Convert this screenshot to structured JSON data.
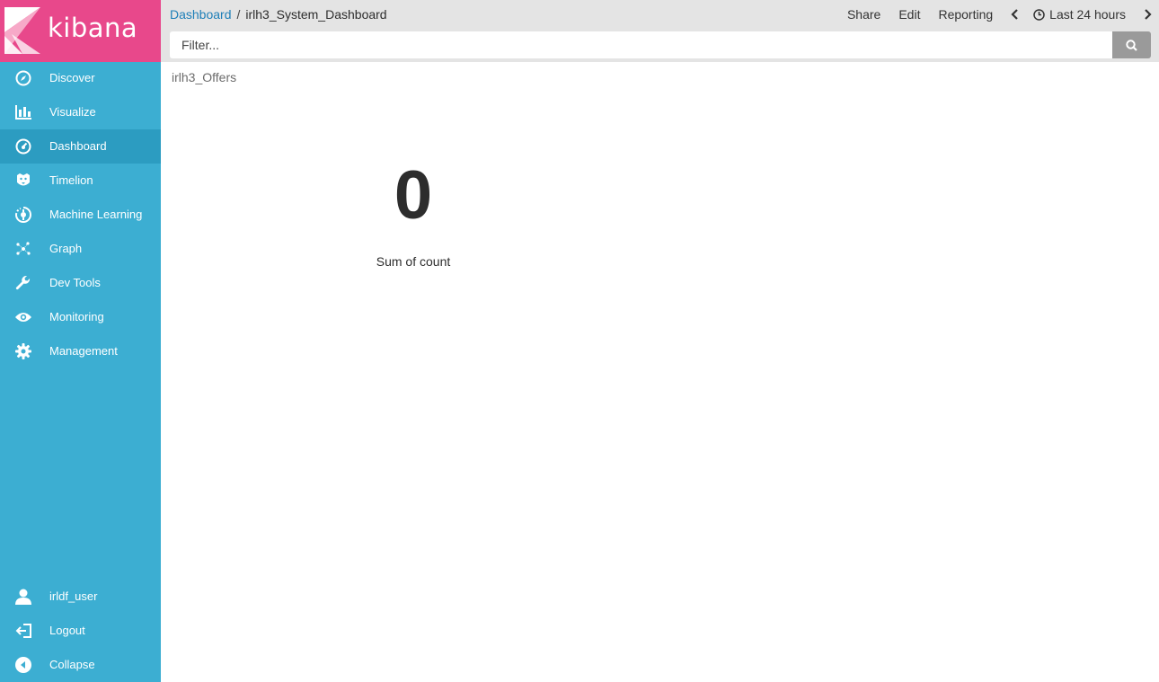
{
  "brand": {
    "name": "kibana",
    "color": "#e8488b",
    "sidebar_color": "#3caed2"
  },
  "sidebar": {
    "items": [
      {
        "label": "Discover",
        "icon": "compass-icon"
      },
      {
        "label": "Visualize",
        "icon": "bar-chart-icon"
      },
      {
        "label": "Dashboard",
        "icon": "dashboard-icon",
        "active": true
      },
      {
        "label": "Timelion",
        "icon": "timelion-icon"
      },
      {
        "label": "Machine Learning",
        "icon": "machine-learning-icon"
      },
      {
        "label": "Graph",
        "icon": "graph-icon"
      },
      {
        "label": "Dev Tools",
        "icon": "wrench-icon"
      },
      {
        "label": "Monitoring",
        "icon": "eye-icon"
      },
      {
        "label": "Management",
        "icon": "gear-icon"
      }
    ],
    "bottom": [
      {
        "label": "irldf_user",
        "icon": "user-icon"
      },
      {
        "label": "Logout",
        "icon": "logout-icon"
      },
      {
        "label": "Collapse",
        "icon": "collapse-icon"
      }
    ]
  },
  "breadcrumb": {
    "root": "Dashboard",
    "separator": "/",
    "current": "irlh3_System_Dashboard"
  },
  "toolbar": {
    "share": "Share",
    "edit": "Edit",
    "reporting": "Reporting",
    "time_range": "Last 24 hours"
  },
  "filter": {
    "placeholder": "Filter...",
    "value": ""
  },
  "panel": {
    "title": "irlh3_Offers",
    "metric_value": "0",
    "metric_label": "Sum of count"
  }
}
